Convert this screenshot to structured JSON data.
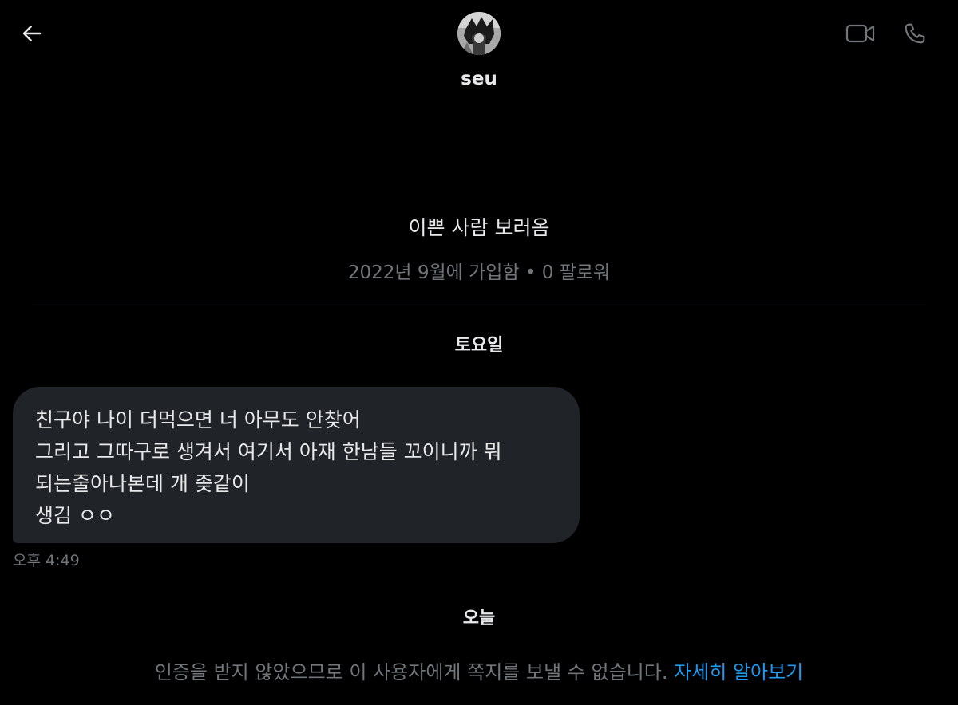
{
  "header": {
    "name": "seu",
    "back_icon": "arrow-left-icon",
    "video_icon": "video-camera-icon",
    "call_icon": "phone-icon"
  },
  "profile": {
    "bio": "이쁜 사람 보러옴",
    "joined": "2022년 9월에 가입함 • 0 팔로워"
  },
  "conversation": {
    "day_saturday": "토요일",
    "message": {
      "lines": [
        "친구야 나이 더먹으면 너 아무도 안찾어",
        "그리고 그따구로 생겨서 여기서 아재 한남들 꼬이니까 뭐",
        "되는줄아나본데 개 좆같이",
        "생김 ㅇㅇ"
      ],
      "time": "오후 4:49"
    },
    "day_today": "오늘"
  },
  "notice": {
    "text": "인증을 받지 않았으므로 이 사용자에게 쪽지를 보낼 수 없습니다. ",
    "link": "자세히 알아보기"
  },
  "colors": {
    "background": "#000000",
    "primary_text": "#e7e9ea",
    "secondary_text": "#71767b",
    "bubble": "#202327",
    "link": "#1d9bf0",
    "divider": "#3a3d42"
  }
}
